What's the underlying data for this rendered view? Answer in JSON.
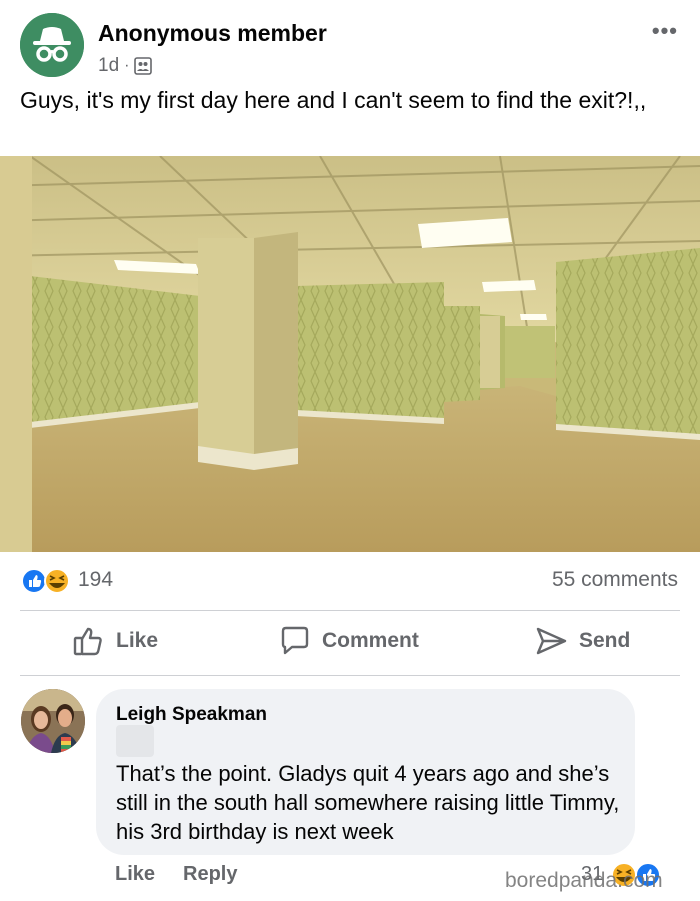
{
  "post": {
    "author": "Anonymous member",
    "time": "1d",
    "separator": "·",
    "audience_icon": "members-icon",
    "more_label": "•••",
    "text": "Guys, it's my first day here and I can't seem to find the exit?!,,",
    "image_icon": "backrooms-photo"
  },
  "reactions": {
    "types": [
      "like",
      "haha"
    ],
    "count": "194",
    "comments_label": "55 comments"
  },
  "actions": {
    "like": "Like",
    "comment": "Comment",
    "send": "Send"
  },
  "comment": {
    "author": "Leigh Speakman",
    "text": "That’s the point. Gladys quit 4 years ago and she’s still in the south hall somewhere raising little Timmy, his 3rd birthday is next week",
    "like_label": "Like",
    "reply_label": "Reply",
    "reaction_count": "31",
    "reaction_types": [
      "haha",
      "like"
    ]
  },
  "watermark": "boredpanda.com",
  "colors": {
    "facebook_blue": "#1877f2",
    "haha_yellow": "#f7b125",
    "anon_green": "#3e8d62",
    "muted_text": "#65676b",
    "bubble_bg": "#f0f2f5"
  }
}
